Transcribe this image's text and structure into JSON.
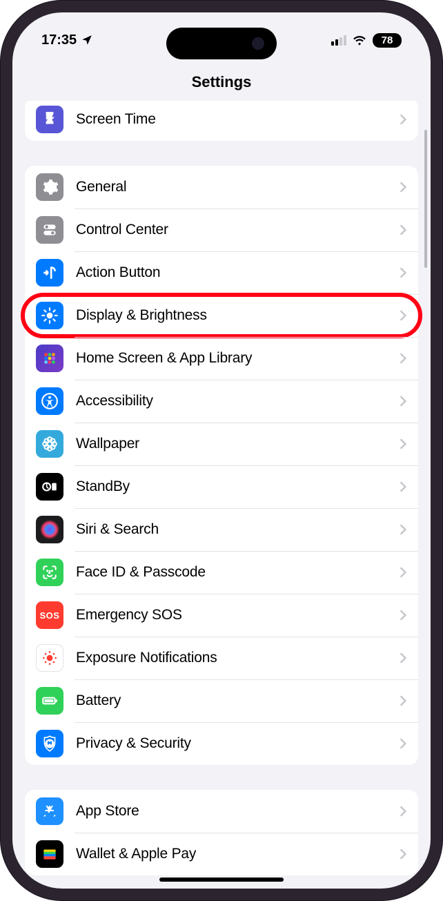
{
  "status": {
    "time": "17:35",
    "battery": "78"
  },
  "title": "Settings",
  "group0": {
    "items": [
      {
        "label": "Screen Time"
      }
    ]
  },
  "group1": {
    "items": [
      {
        "label": "General"
      },
      {
        "label": "Control Center"
      },
      {
        "label": "Action Button"
      },
      {
        "label": "Display & Brightness"
      },
      {
        "label": "Home Screen & App Library"
      },
      {
        "label": "Accessibility"
      },
      {
        "label": "Wallpaper"
      },
      {
        "label": "StandBy"
      },
      {
        "label": "Siri & Search"
      },
      {
        "label": "Face ID & Passcode"
      },
      {
        "label": "Emergency SOS"
      },
      {
        "label": "Exposure Notifications"
      },
      {
        "label": "Battery"
      },
      {
        "label": "Privacy & Security"
      }
    ]
  },
  "group2": {
    "items": [
      {
        "label": "App Store"
      },
      {
        "label": "Wallet & Apple Pay"
      }
    ]
  },
  "highlight": "Display & Brightness"
}
